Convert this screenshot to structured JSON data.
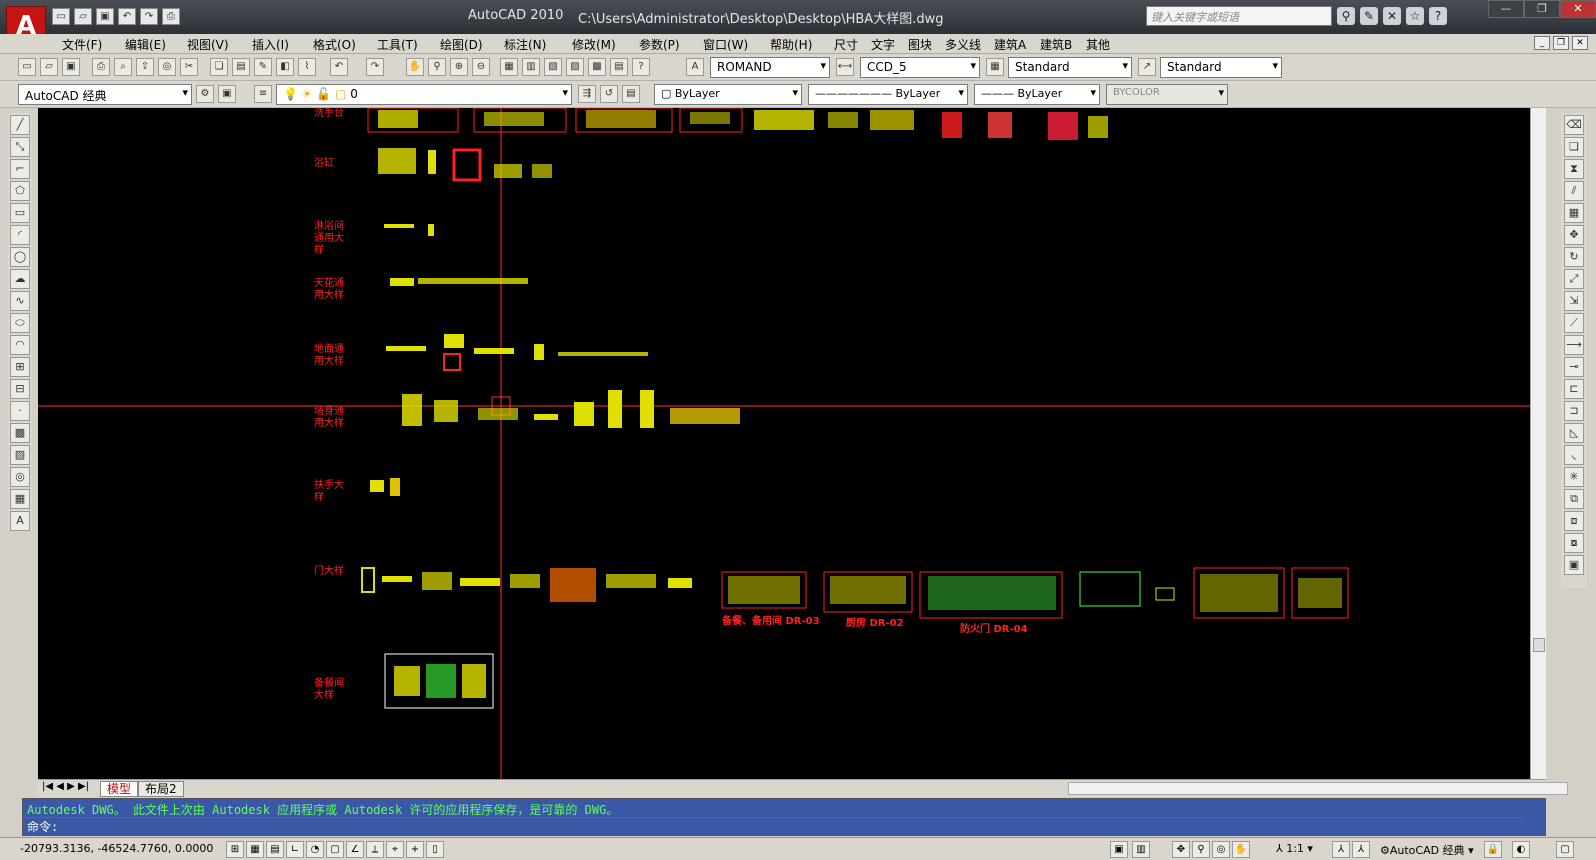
{
  "window": {
    "app_title": "AutoCAD 2010",
    "file_path": "C:\\Users\\Administrator\\Desktop\\Desktop\\HBA大样图.dwg",
    "search_placeholder": "键入关键字或短语",
    "logo_letter": "A"
  },
  "menu": [
    "文件(F)",
    "编辑(E)",
    "视图(V)",
    "插入(I)",
    "格式(O)",
    "工具(T)",
    "绘图(D)",
    "标注(N)",
    "修改(M)",
    "参数(P)",
    "窗口(W)",
    "帮助(H)",
    "尺寸",
    "文字",
    "图块",
    "多义线",
    "建筑A",
    "建筑B",
    "其他"
  ],
  "styles": {
    "text_style_font": "ROMAND",
    "dim_style": "CCD_5",
    "table_style": "Standard",
    "multileader_style": "Standard"
  },
  "layers": {
    "workspace": "AutoCAD 经典",
    "current_layer": "0",
    "color": "ByLayer",
    "linetype": "ByLayer",
    "lineweight": "ByLayer",
    "plotstyle": "BYCOLOR"
  },
  "drawing": {
    "row_labels": [
      {
        "text": "洗手台"
      },
      {
        "text": "浴缸"
      },
      {
        "text": "淋浴间\n通用大\n样"
      },
      {
        "text": "天花通\n用大样"
      },
      {
        "text": "地面通\n用大样"
      },
      {
        "text": "墙身通\n用大样"
      },
      {
        "text": "扶手大\n样"
      },
      {
        "text": "门大样"
      },
      {
        "text": "备餐间\n大样"
      }
    ],
    "captions": [
      "备餐、备用间 DR-03",
      "厨房 DR-02",
      "防火门 DR-04"
    ]
  },
  "tabs": [
    "模型",
    "布局2"
  ],
  "command": {
    "history": "Autodesk DWG。  此文件上次由 Autodesk 应用程序或 Autodesk 许可的应用程序保存，是可靠的 DWG。",
    "prompt": "命令:"
  },
  "status": {
    "coordinates": "-20793.3136, -46524.7760, 0.0000",
    "annotation_scale": "1:1",
    "workspace": "AutoCAD 经典"
  },
  "colors": {
    "canvas": "#000000",
    "command_bg": "#3a58a5",
    "crosshair": "#ff3030"
  }
}
